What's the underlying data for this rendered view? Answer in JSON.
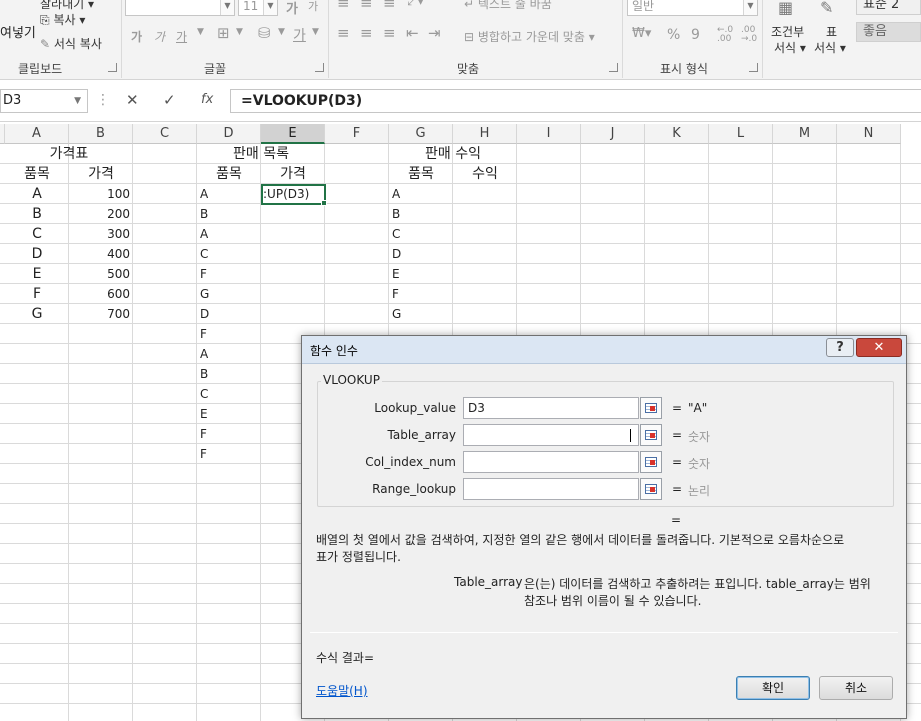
{
  "ribbon": {
    "clipboard": {
      "paste_label": "여넣기",
      "copy_label": "복사",
      "format_painter_label": "서식 복사",
      "cut_label": "잘라내기",
      "group_label": "클립보드"
    },
    "font": {
      "font_size": "11",
      "bold": "가",
      "italic": "가",
      "underline": "가",
      "font_color_glyph": "가",
      "group_label": "글꼴"
    },
    "alignment": {
      "wrap_text_label": "텍스트 줄 바꿈",
      "merge_label": "병합하고 가운데 맞춤",
      "group_label": "맞춤"
    },
    "number": {
      "format_value": "일반",
      "percent": "%",
      "comma": "9",
      "dec_inc": "←.0 .00",
      "dec_dec": ".00 →.0",
      "group_label": "표시 형식"
    },
    "styles": {
      "conditional_label_1": "조건부",
      "conditional_label_2": "서식",
      "table_label_1": "표",
      "table_label_2": "서식",
      "style_normal2": "표준 2",
      "style_good": "좋음"
    }
  },
  "formula_bar": {
    "name_box": "D3",
    "cancel": "✕",
    "enter": "✓",
    "fx": "fx",
    "formula": "=VLOOKUP(D3)"
  },
  "columns": [
    "A",
    "B",
    "C",
    "D",
    "E",
    "F",
    "G",
    "H",
    "I",
    "J",
    "K",
    "L",
    "M",
    "N"
  ],
  "sheet": {
    "price_title": "가격표",
    "price_head_item": "품목",
    "price_head_price": "가격",
    "price_items": [
      "A",
      "B",
      "C",
      "D",
      "E",
      "F",
      "G"
    ],
    "price_values": [
      "100",
      "200",
      "300",
      "400",
      "500",
      "600",
      "700"
    ],
    "sales_title": "판매 목록",
    "sales_head_item": "품목",
    "sales_head_price": "가격",
    "sales_items": [
      "A",
      "B",
      "A",
      "C",
      "F",
      "G",
      "D",
      "F",
      "A",
      "B",
      "C",
      "E",
      "F",
      "F"
    ],
    "active_cell_text": ":UP(D3)",
    "revenue_title": "판매 수익",
    "revenue_head_item": "품목",
    "revenue_head_revenue": "수익",
    "revenue_items": [
      "A",
      "B",
      "C",
      "D",
      "E",
      "F",
      "G"
    ]
  },
  "dialog": {
    "title": "함수 인수",
    "help_button": "?",
    "close_button": "✕",
    "function_name": "VLOOKUP",
    "args": [
      {
        "label": "Lookup_value",
        "value": "D3",
        "result": "\"A\""
      },
      {
        "label": "Table_array",
        "value": "",
        "result": "숫자"
      },
      {
        "label": "Col_index_num",
        "value": "",
        "result": "숫자"
      },
      {
        "label": "Range_lookup",
        "value": "",
        "result": "논리"
      }
    ],
    "equals": "=",
    "result_equals": "=",
    "description_line1": "배열의 첫 열에서 값을 검색하여, 지정한 열의 같은 행에서 데이터를 돌려줍니다. 기본적으로 오름차순으로",
    "description_line2": "표가 정렬됩니다.",
    "arg_help_name": "Table_array",
    "arg_help_line1": "은(는) 데이터를 검색하고 추출하려는 표입니다. table_array는 범위",
    "arg_help_line2": "참조나 범위 이름이 될 수 있습니다.",
    "formula_result_label": "수식 결과=",
    "help_link": "도움말(H)",
    "ok_button": "확인",
    "cancel_button": "취소"
  }
}
